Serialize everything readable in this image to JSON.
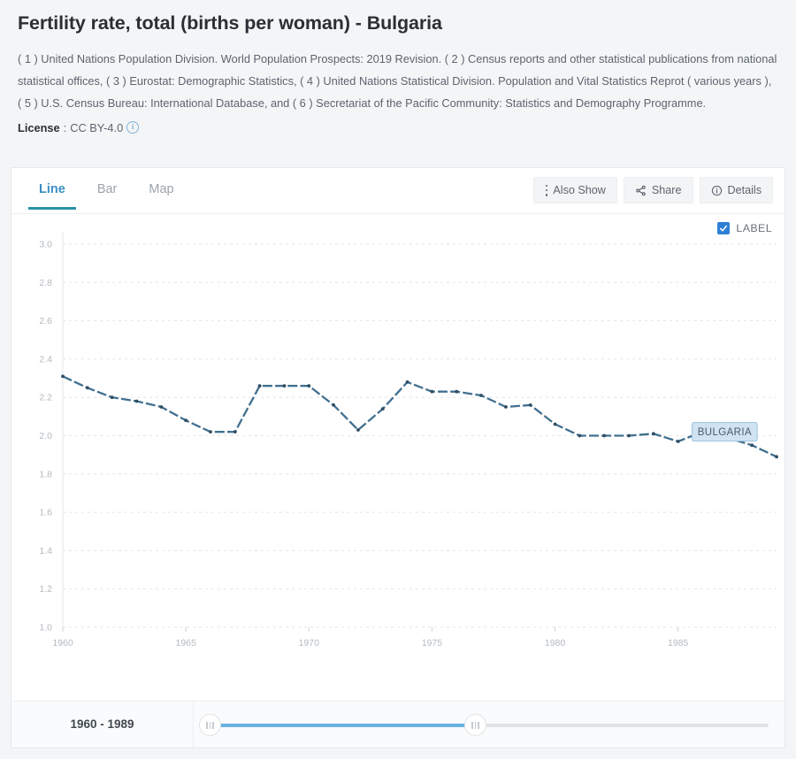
{
  "header": {
    "title": "Fertility rate, total (births per woman) - Bulgaria",
    "sources": "( 1 ) United Nations Population Division. World Population Prospects: 2019 Revision. ( 2 ) Census reports and other statistical publications from national statistical offices, ( 3 ) Eurostat: Demographic Statistics, ( 4 ) United Nations Statistical Division. Population and Vital Statistics Reprot ( various years ), ( 5 ) U.S. Census Bureau: International Database, and ( 6 ) Secretariat of the Pacific Community: Statistics and Demography Programme.",
    "license_label": "License",
    "license_sep": ":",
    "license_value": "CC BY-4.0",
    "license_info_icon": "info-circle-icon"
  },
  "tabs": [
    {
      "label": "Line",
      "active": true
    },
    {
      "label": "Bar",
      "active": false
    },
    {
      "label": "Map",
      "active": false
    }
  ],
  "toolbar": [
    {
      "label": "Also Show",
      "icon": "vertical-dots-icon"
    },
    {
      "label": "Share",
      "icon": "share-icon"
    },
    {
      "label": "Details",
      "icon": "info-circle-icon"
    }
  ],
  "legend": {
    "label": "LABEL",
    "checked": true,
    "icon": "checkbox-checked-icon",
    "accent": "#2f7fd4"
  },
  "slider": {
    "range_label": "1960 - 1989",
    "left_handle_icon": "slider-handle-icon",
    "right_handle_icon": "slider-handle-icon",
    "fill_color": "#67b2e0",
    "track_color": "#e0e3e6"
  },
  "chart_data": {
    "type": "line",
    "title": "Fertility rate, total (births per woman) - Bulgaria",
    "xlabel": "",
    "ylabel": "",
    "xlim": [
      1960,
      1989
    ],
    "ylim": [
      1.0,
      3.0
    ],
    "yticks": [
      1.0,
      1.2,
      1.4,
      1.6,
      1.8,
      2.0,
      2.2,
      2.4,
      2.6,
      2.8,
      3.0
    ],
    "ytick_labels": [
      "1.0",
      "1.2",
      "1.4",
      "1.6",
      "1.8",
      "2.0",
      "2.2",
      "2.4",
      "2.6",
      "2.8",
      "3.0"
    ],
    "xticks": [
      1960,
      1965,
      1970,
      1975,
      1980,
      1985
    ],
    "xtick_labels": [
      "1960",
      "1965",
      "1970",
      "1975",
      "1980",
      "1985"
    ],
    "grid": true,
    "legend_position": "top-right",
    "annotations": [
      {
        "text": "BULGARIA",
        "x": 1988,
        "y": 2.02,
        "style": "callout-badge"
      }
    ],
    "series": [
      {
        "name": "BULGARIA",
        "color": "#41708f",
        "x": [
          1960,
          1961,
          1962,
          1963,
          1964,
          1965,
          1966,
          1967,
          1968,
          1969,
          1970,
          1971,
          1972,
          1973,
          1974,
          1975,
          1976,
          1977,
          1978,
          1979,
          1980,
          1981,
          1982,
          1983,
          1984,
          1985,
          1986,
          1987,
          1988,
          1989
        ],
        "values": [
          2.31,
          2.25,
          2.2,
          2.18,
          2.15,
          2.08,
          2.02,
          2.02,
          2.26,
          2.26,
          2.26,
          2.16,
          2.03,
          2.14,
          2.28,
          2.23,
          2.23,
          2.21,
          2.15,
          2.16,
          2.06,
          2.0,
          2.0,
          2.0,
          2.01,
          1.97,
          2.02,
          1.99,
          1.95,
          1.89
        ]
      }
    ]
  }
}
